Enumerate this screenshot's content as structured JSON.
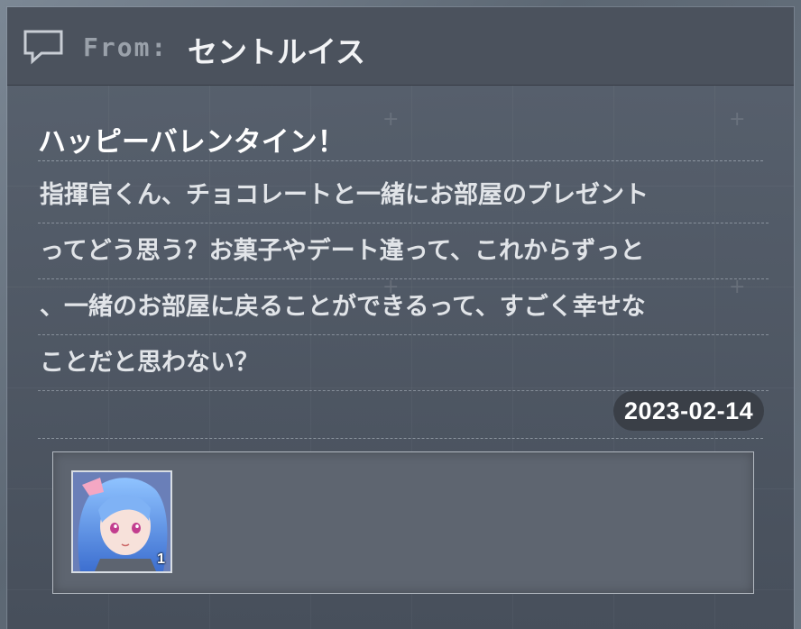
{
  "header": {
    "from_label": "From:",
    "sender_name": "セントルイス",
    "icon": "chat-bubble-icon"
  },
  "message": {
    "subject": "ハッピーバレンタイン！",
    "body_lines": [
      "指揮官くん、チョコレートと一緒にお部屋のプレゼント",
      "ってどう思う？お菓子やデート違って、これからずっと",
      "、一緒のお部屋に戻ることができるって、すごく幸せな",
      "ことだと思わない？"
    ],
    "date": "2023-02-14"
  },
  "attachment": {
    "items": [
      {
        "icon": "character-portrait-icon",
        "count": "1"
      }
    ]
  },
  "colors": {
    "header_bg": "#4b525d",
    "panel_bg": "#58616e",
    "date_badge_bg": "#3a3f47",
    "from_label": "#9aa1aa",
    "text": "#e1e4e8"
  }
}
